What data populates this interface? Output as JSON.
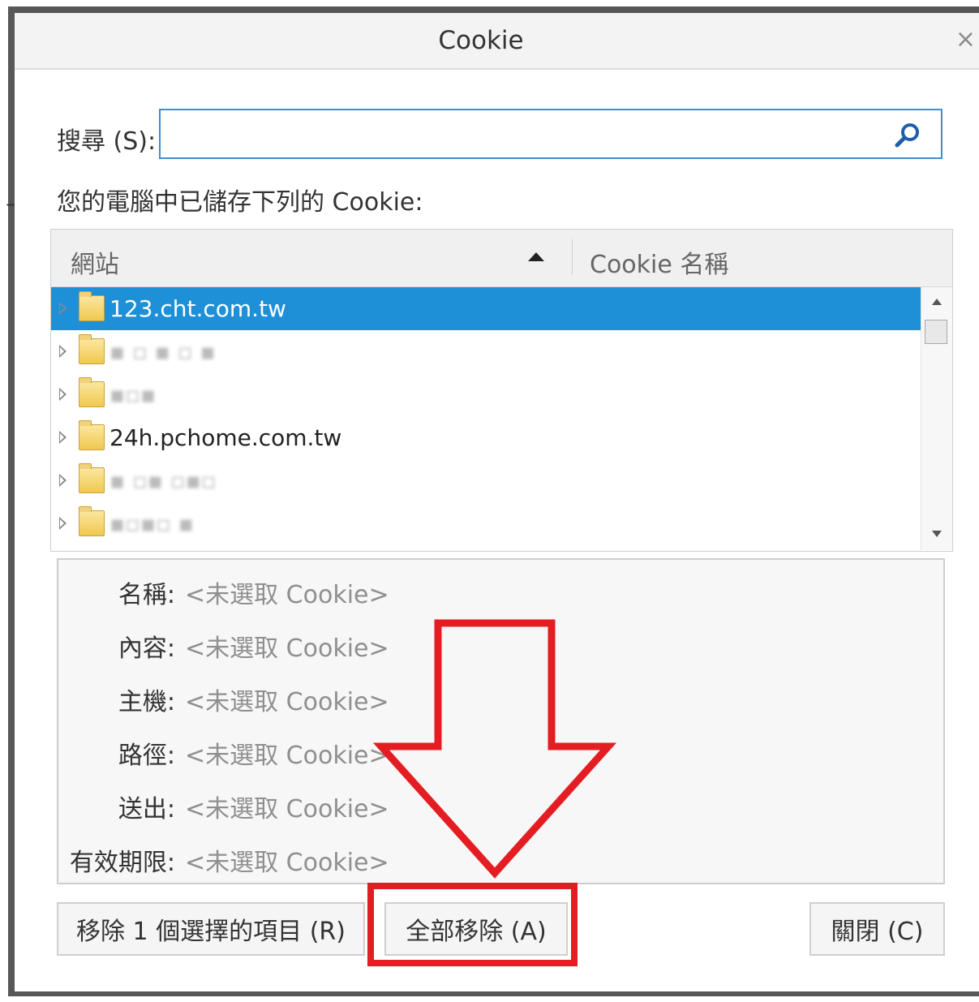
{
  "dialog": {
    "title": "Cookie",
    "close_glyph": "×"
  },
  "search": {
    "label": "搜尋 (S):",
    "value": "",
    "placeholder": ""
  },
  "cookies_label": "您的電腦中已儲存下列的 Cookie:",
  "table": {
    "columns": [
      "網站",
      "Cookie 名稱"
    ],
    "sort": "ascending",
    "rows": [
      {
        "site": "123.cht.com.tw",
        "selected": true
      },
      {
        "site": "",
        "selected": false
      },
      {
        "site": "",
        "selected": false
      },
      {
        "site": "24h.pchome.com.tw",
        "selected": false
      },
      {
        "site": "",
        "selected": false
      },
      {
        "site": "",
        "selected": false
      }
    ]
  },
  "details": [
    {
      "key": "名稱:",
      "value": "<未選取 Cookie>"
    },
    {
      "key": "內容:",
      "value": "<未選取 Cookie>"
    },
    {
      "key": "主機:",
      "value": "<未選取 Cookie>"
    },
    {
      "key": "路徑:",
      "value": "<未選取 Cookie>"
    },
    {
      "key": "送出:",
      "value": "<未選取 Cookie>"
    },
    {
      "key": "有效期限:",
      "value": "<未選取 Cookie>"
    }
  ],
  "buttons": {
    "remove_selected": "移除 1 個選擇的項目 (R)",
    "remove_all": "全部移除 (A)",
    "close": "關閉 (C)"
  },
  "colors": {
    "selection": "#1e90d8",
    "annotation": "#e41d23",
    "search_border": "#3c8fd6"
  },
  "icons": [
    "search-icon",
    "folder-icon",
    "expand-arrow-icon",
    "sort-ascending-icon",
    "close-icon"
  ]
}
